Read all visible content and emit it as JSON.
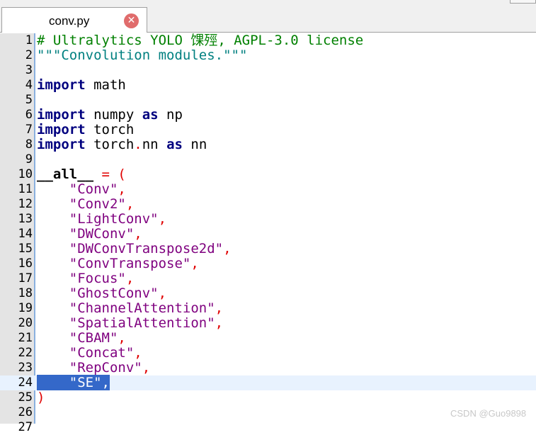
{
  "tab": {
    "filename": "conv.py",
    "close_glyph": "✕"
  },
  "lines": [
    {
      "n": "1",
      "parts": [
        {
          "t": "# Ultralytics YOLO 馃殌, AGPL-3.0 license",
          "c": "cm"
        }
      ]
    },
    {
      "n": "2",
      "parts": [
        {
          "t": "\"\"\"Convolution modules.\"\"\"",
          "c": "docstr"
        }
      ]
    },
    {
      "n": "3",
      "parts": []
    },
    {
      "n": "4",
      "parts": [
        {
          "t": "import",
          "c": "kw"
        },
        {
          "t": " math",
          "c": ""
        }
      ]
    },
    {
      "n": "5",
      "parts": []
    },
    {
      "n": "6",
      "parts": [
        {
          "t": "import",
          "c": "kw"
        },
        {
          "t": " numpy ",
          "c": ""
        },
        {
          "t": "as",
          "c": "kw"
        },
        {
          "t": " np",
          "c": ""
        }
      ]
    },
    {
      "n": "7",
      "parts": [
        {
          "t": "import",
          "c": "kw"
        },
        {
          "t": " torch",
          "c": ""
        }
      ]
    },
    {
      "n": "8",
      "parts": [
        {
          "t": "import",
          "c": "kw"
        },
        {
          "t": " torch",
          "c": ""
        },
        {
          "t": ".",
          "c": "op"
        },
        {
          "t": "nn ",
          "c": ""
        },
        {
          "t": "as",
          "c": "kw"
        },
        {
          "t": " nn",
          "c": ""
        }
      ]
    },
    {
      "n": "9",
      "parts": []
    },
    {
      "n": "10",
      "parts": [
        {
          "t": "__all__",
          "c": "dunder"
        },
        {
          "t": " = (",
          "c": "op"
        }
      ]
    },
    {
      "n": "11",
      "parts": [
        {
          "t": "    ",
          "c": ""
        },
        {
          "t": "\"Conv\"",
          "c": "str2"
        },
        {
          "t": ",",
          "c": "op"
        }
      ]
    },
    {
      "n": "12",
      "parts": [
        {
          "t": "    ",
          "c": ""
        },
        {
          "t": "\"Conv2\"",
          "c": "str2"
        },
        {
          "t": ",",
          "c": "op"
        }
      ]
    },
    {
      "n": "13",
      "parts": [
        {
          "t": "    ",
          "c": ""
        },
        {
          "t": "\"LightConv\"",
          "c": "str2"
        },
        {
          "t": ",",
          "c": "op"
        }
      ]
    },
    {
      "n": "14",
      "parts": [
        {
          "t": "    ",
          "c": ""
        },
        {
          "t": "\"DWConv\"",
          "c": "str2"
        },
        {
          "t": ",",
          "c": "op"
        }
      ]
    },
    {
      "n": "15",
      "parts": [
        {
          "t": "    ",
          "c": ""
        },
        {
          "t": "\"DWConvTranspose2d\"",
          "c": "str2"
        },
        {
          "t": ",",
          "c": "op"
        }
      ]
    },
    {
      "n": "16",
      "parts": [
        {
          "t": "    ",
          "c": ""
        },
        {
          "t": "\"ConvTranspose\"",
          "c": "str2"
        },
        {
          "t": ",",
          "c": "op"
        }
      ]
    },
    {
      "n": "17",
      "parts": [
        {
          "t": "    ",
          "c": ""
        },
        {
          "t": "\"Focus\"",
          "c": "str2"
        },
        {
          "t": ",",
          "c": "op"
        }
      ]
    },
    {
      "n": "18",
      "parts": [
        {
          "t": "    ",
          "c": ""
        },
        {
          "t": "\"GhostConv\"",
          "c": "str2"
        },
        {
          "t": ",",
          "c": "op"
        }
      ]
    },
    {
      "n": "19",
      "parts": [
        {
          "t": "    ",
          "c": ""
        },
        {
          "t": "\"ChannelAttention\"",
          "c": "str2"
        },
        {
          "t": ",",
          "c": "op"
        }
      ]
    },
    {
      "n": "20",
      "parts": [
        {
          "t": "    ",
          "c": ""
        },
        {
          "t": "\"SpatialAttention\"",
          "c": "str2"
        },
        {
          "t": ",",
          "c": "op"
        }
      ]
    },
    {
      "n": "21",
      "parts": [
        {
          "t": "    ",
          "c": ""
        },
        {
          "t": "\"CBAM\"",
          "c": "str2"
        },
        {
          "t": ",",
          "c": "op"
        }
      ]
    },
    {
      "n": "22",
      "parts": [
        {
          "t": "    ",
          "c": ""
        },
        {
          "t": "\"Concat\"",
          "c": "str2"
        },
        {
          "t": ",",
          "c": "op"
        }
      ]
    },
    {
      "n": "23",
      "parts": [
        {
          "t": "    ",
          "c": ""
        },
        {
          "t": "\"RepConv\"",
          "c": "str2"
        },
        {
          "t": ",",
          "c": "op"
        }
      ]
    },
    {
      "n": "24",
      "selected": true,
      "parts": [
        {
          "t": "    \"SE\",",
          "c": "seltext"
        }
      ]
    },
    {
      "n": "25",
      "parts": [
        {
          "t": ")",
          "c": "op"
        }
      ]
    },
    {
      "n": "26",
      "parts": []
    },
    {
      "n": "27",
      "parts": []
    }
  ],
  "watermark": "CSDN @Guo9898",
  "colors": {
    "gutter": "#e4e4e4",
    "selection": "#3468c9",
    "current_line": "#e8f2fe",
    "keyword": "#00007f",
    "string": "#7f007f",
    "comment": "#008000",
    "operator": "#e00000"
  }
}
